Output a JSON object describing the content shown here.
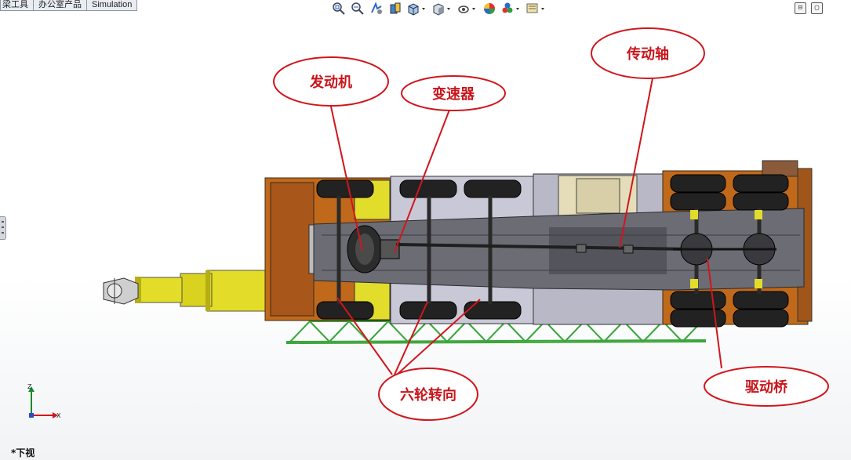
{
  "command_tabs": [
    "梁工具",
    "办公室产品",
    "Simulation"
  ],
  "heads_up_toolbar": [
    {
      "icon": "zoom-to-fit-icon"
    },
    {
      "icon": "zoom-to-area-icon"
    },
    {
      "icon": "previous-view-icon"
    },
    {
      "icon": "section-view-icon"
    },
    {
      "icon": "view-orientation-icon",
      "dropdown": true
    },
    {
      "icon": "display-style-icon",
      "dropdown": true
    },
    {
      "icon": "hide-show-items-icon",
      "dropdown": true
    },
    {
      "icon": "edit-appearance-icon"
    },
    {
      "icon": "apply-scene-icon",
      "dropdown": true
    },
    {
      "icon": "view-settings-icon",
      "dropdown": true
    }
  ],
  "callouts": {
    "engine": "发动机",
    "transmission": "变速器",
    "drive_shaft": "传动轴",
    "six_wheel_steering": "六轮转向",
    "drive_axle": "驱动桥"
  },
  "colors": {
    "callout_red": "#d0161c",
    "cab_orange": "#c0691b",
    "boom_yellow": "#e3dd2a",
    "frame_grey": "#6c6c74",
    "outrigger_green": "#3aa53a"
  },
  "triad": {
    "z": "Z",
    "x": "X"
  },
  "view_name": "*下视"
}
